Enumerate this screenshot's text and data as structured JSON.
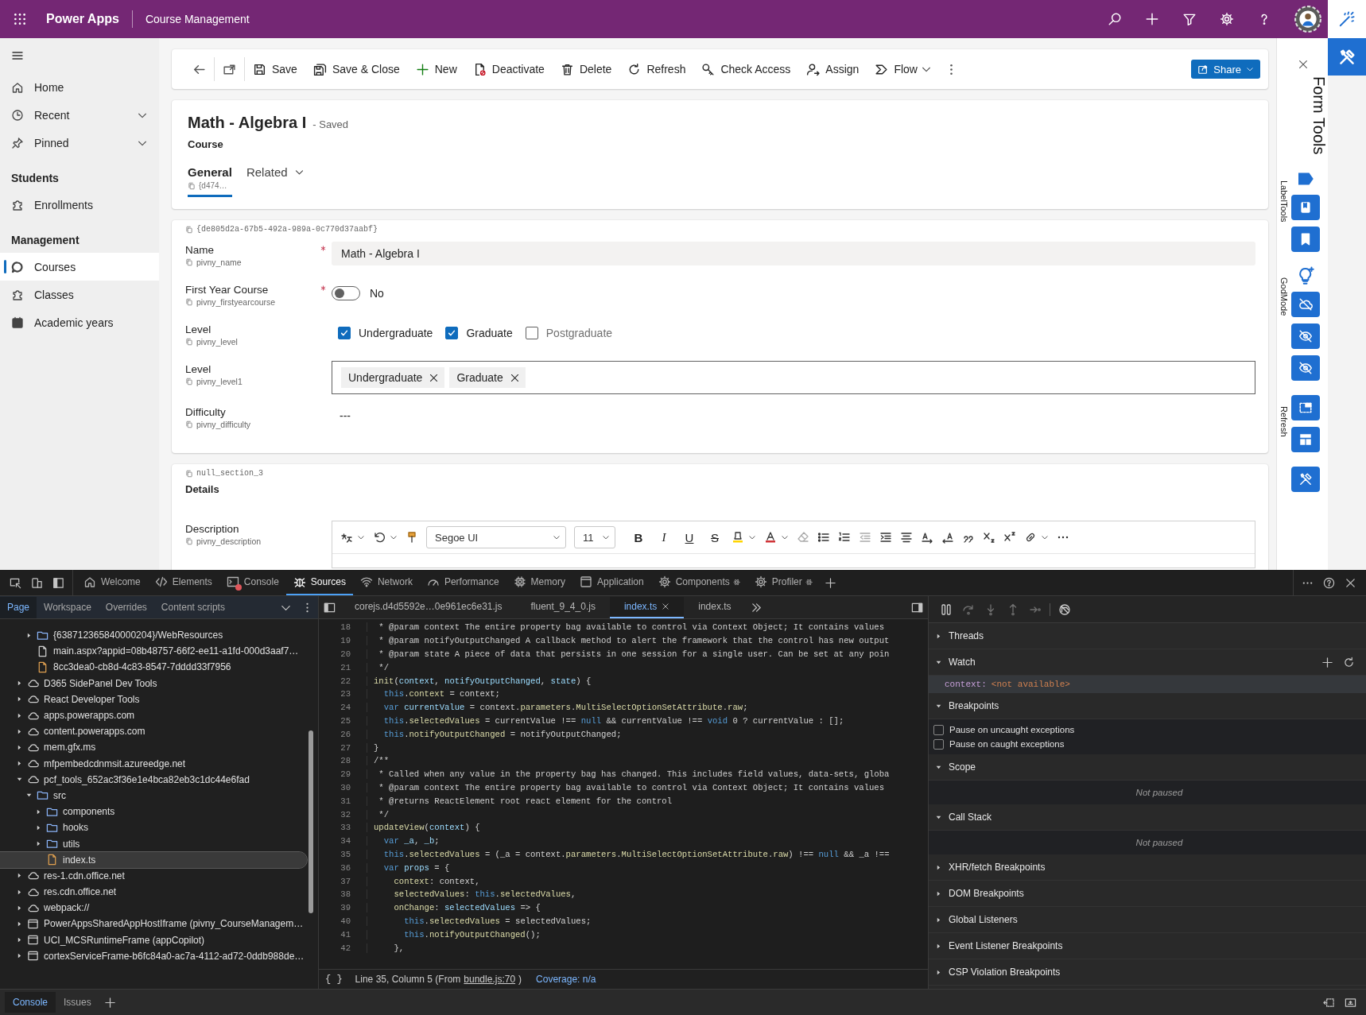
{
  "topbar": {
    "app_name": "Power Apps",
    "title": "Course Management"
  },
  "nav": [
    {
      "kind": "item",
      "label": "Home",
      "selected": false
    },
    {
      "kind": "item",
      "label": "Recent",
      "expanded": false,
      "selected": false
    },
    {
      "kind": "item",
      "label": "Pinned",
      "expanded": false,
      "selected": false
    },
    {
      "kind": "group",
      "label": "Students"
    },
    {
      "kind": "item",
      "label": "Enrollments",
      "selected": false
    },
    {
      "kind": "group",
      "label": "Management"
    },
    {
      "kind": "item",
      "label": "Courses",
      "selected": true
    },
    {
      "kind": "item",
      "label": "Classes",
      "selected": false
    },
    {
      "kind": "item",
      "label": "Academic years",
      "selected": false
    }
  ],
  "commands": [
    "Save",
    "Save & Close",
    "New",
    "Deactivate",
    "Delete",
    "Refresh",
    "Check Access",
    "Assign",
    "Flow"
  ],
  "share": "Share",
  "record": {
    "title": "Math - Algebra I",
    "status": "- Saved",
    "entity": "Course",
    "tabs": [
      {
        "label": "General",
        "selected": true,
        "id": "{d474…"
      },
      {
        "label": "Related",
        "selected": false,
        "dropdown": true
      }
    ]
  },
  "sections": [
    {
      "id": "{de805d2a-67b5-492a-989a-0c770d37aabf}",
      "fields": [
        {
          "kind": "text",
          "label": "Name",
          "schema": "pivny_name",
          "required": true,
          "value": "Math - Algebra I"
        },
        {
          "kind": "toggle",
          "label": "First Year Course",
          "schema": "pivny_firstyearcourse",
          "required": true,
          "on": false,
          "value": "No"
        },
        {
          "kind": "checkboxes",
          "label": "Level",
          "schema": "pivny_level",
          "options": [
            {
              "label": "Undergraduate",
              "checked": true
            },
            {
              "label": "Graduate",
              "checked": true
            },
            {
              "label": "Postgraduate",
              "checked": false
            }
          ]
        },
        {
          "kind": "tags",
          "label": "Level",
          "schema": "pivny_level1",
          "tags": [
            "Undergraduate",
            "Graduate"
          ]
        },
        {
          "kind": "readonly",
          "label": "Difficulty",
          "schema": "pivny_difficulty",
          "value": "---"
        }
      ]
    },
    {
      "id": "null_section_3",
      "title": "Details",
      "fields": [
        {
          "kind": "richtext",
          "label": "Description",
          "schema": "pivny_description",
          "font": "Segoe UI",
          "size": "11",
          "format_buttons": [
            {
              "kind": "bold",
              "glyph": "B"
            },
            {
              "kind": "italic",
              "glyph": "I"
            },
            {
              "kind": "underline",
              "glyph": "U"
            },
            {
              "kind": "strike",
              "glyph": "S"
            }
          ]
        }
      ]
    }
  ],
  "form_tools": {
    "title": "Form Tools",
    "groups": [
      {
        "label": "LabelTools"
      },
      {
        "label": "GodMode"
      },
      {
        "label": "Refresh"
      }
    ]
  },
  "devtools": {
    "tabs": [
      {
        "label": "Welcome",
        "selected": false
      },
      {
        "label": "Elements",
        "selected": false
      },
      {
        "label": "Console",
        "selected": false,
        "error": true
      },
      {
        "label": "Sources",
        "selected": true
      },
      {
        "label": "Network",
        "selected": false
      },
      {
        "label": "Performance",
        "selected": false
      },
      {
        "label": "Memory",
        "selected": false
      },
      {
        "label": "Application",
        "selected": false
      },
      {
        "label": "Components",
        "selected": false,
        "react": true
      },
      {
        "label": "Profiler",
        "selected": false,
        "react": true
      }
    ]
  },
  "sources": {
    "nav_tabs": [
      {
        "label": "Page",
        "selected": true
      },
      {
        "label": "Workspace",
        "selected": false
      },
      {
        "label": "Overrides",
        "selected": false
      },
      {
        "label": "Content scripts",
        "selected": false
      }
    ],
    "tree": [
      {
        "expanded": true,
        "children": [
          {
            "kind": "folder",
            "label": "{638712365840000204}/WebResources",
            "expanded": false,
            "selected": false
          },
          {
            "kind": "file",
            "label": "main.aspx?appid=08b48757-66f2-ee11-a1fd-000d3aaf7…",
            "selected": false
          },
          {
            "kind": "script",
            "label": "8cc3dea0-cb8d-4c83-8547-7dddd33f7956",
            "selected": false
          }
        ]
      },
      {
        "kind": "cloud",
        "label": "D365 SidePanel Dev Tools",
        "expanded": false,
        "selected": false
      },
      {
        "kind": "cloud",
        "label": "React Developer Tools",
        "expanded": false,
        "selected": false
      },
      {
        "kind": "cloud",
        "label": "apps.powerapps.com",
        "expanded": false,
        "selected": false
      },
      {
        "kind": "cloud",
        "label": "content.powerapps.com",
        "expanded": false,
        "selected": false
      },
      {
        "kind": "cloud",
        "label": "mem.gfx.ms",
        "expanded": false,
        "selected": false
      },
      {
        "kind": "cloud",
        "label": "mfpembedcdnmsit.azureedge.net",
        "expanded": false,
        "selected": false
      },
      {
        "kind": "cloud",
        "label": "pcf_tools_652ac3f36e1e4bca82eb3c1dc44e6fad",
        "expanded": true,
        "selected": false,
        "children": [
          {
            "kind": "folder",
            "label": "src",
            "expanded": true,
            "selected": false,
            "children": [
              {
                "kind": "folder",
                "label": "components",
                "expanded": false,
                "selected": false
              },
              {
                "kind": "folder",
                "label": "hooks",
                "expanded": false,
                "selected": false
              },
              {
                "kind": "folder",
                "label": "utils",
                "expanded": false,
                "selected": false
              },
              {
                "kind": "script",
                "label": "index.ts",
                "selected": true
              }
            ]
          }
        ]
      },
      {
        "kind": "cloud",
        "label": "res-1.cdn.office.net",
        "expanded": false,
        "selected": false
      },
      {
        "kind": "cloud",
        "label": "res.cdn.office.net",
        "expanded": false,
        "selected": false
      },
      {
        "kind": "cloud",
        "label": "webpack://",
        "expanded": false,
        "selected": false
      },
      {
        "kind": "frame",
        "label": "PowerAppsSharedAppHostIframe (pivny_CourseManagem…",
        "expanded": false,
        "selected": false
      },
      {
        "kind": "frame",
        "label": "UCI_MCSRuntimeFrame (appCopilot)",
        "expanded": false,
        "selected": false
      },
      {
        "kind": "frame",
        "label": "cortexServiceFrame-b6fc84a0-ac7a-4112-ad72-0ddb988de…",
        "expanded": false,
        "selected": false
      }
    ],
    "editor_tabs": [
      {
        "label": "corejs.d4d5592e…0e961ec6e31.js",
        "selected": false
      },
      {
        "label": "fluent_9_4_0.js",
        "selected": false
      },
      {
        "label": "index.ts",
        "selected": true,
        "closable": true
      },
      {
        "label": "index.ts",
        "selected": false
      }
    ],
    "code": [
      {
        "number": "18",
        "tokens": [
          {
            "kind": "comment",
            "text": " * @param context The entire property bag available to control via Context Object; It contains values"
          }
        ]
      },
      {
        "number": "19",
        "tokens": [
          {
            "kind": "comment",
            "text": " * @param notifyOutputChanged A callback method to alert the framework that the control has new output"
          }
        ]
      },
      {
        "number": "20",
        "tokens": [
          {
            "kind": "comment",
            "text": " * @param state A piece of data that persists in one session for a single user. Can be set at any poin"
          }
        ]
      },
      {
        "number": "21",
        "tokens": [
          {
            "kind": "comment",
            "text": " */"
          }
        ]
      },
      {
        "number": "22",
        "tokens": [
          {
            "kind": "func",
            "text": "init"
          },
          {
            "kind": "plain",
            "text": "("
          },
          {
            "kind": "var",
            "text": "context"
          },
          {
            "kind": "plain",
            "text": ", "
          },
          {
            "kind": "var",
            "text": "notifyOutputChanged"
          },
          {
            "kind": "plain",
            "text": ", "
          },
          {
            "kind": "var",
            "text": "state"
          },
          {
            "kind": "plain",
            "text": ") {"
          }
        ]
      },
      {
        "number": "23",
        "tokens": [
          {
            "kind": "keyword",
            "text": "  this"
          },
          {
            "kind": "plain",
            "text": "."
          },
          {
            "kind": "func",
            "text": "context"
          },
          {
            "kind": "plain",
            "text": " = context;"
          }
        ]
      },
      {
        "number": "24",
        "tokens": [
          {
            "kind": "keyword",
            "text": "  var "
          },
          {
            "kind": "var",
            "text": "currentValue"
          },
          {
            "kind": "plain",
            "text": " = context."
          },
          {
            "kind": "func",
            "text": "parameters"
          },
          {
            "kind": "plain",
            "text": "."
          },
          {
            "kind": "func",
            "text": "MultiSelectOptionSetAttribute"
          },
          {
            "kind": "plain",
            "text": "."
          },
          {
            "kind": "func",
            "text": "raw"
          },
          {
            "kind": "plain",
            "text": ";"
          }
        ]
      },
      {
        "number": "25",
        "tokens": [
          {
            "kind": "keyword",
            "text": "  this"
          },
          {
            "kind": "plain",
            "text": "."
          },
          {
            "kind": "func",
            "text": "selectedValues"
          },
          {
            "kind": "plain",
            "text": " = currentValue !== "
          },
          {
            "kind": "keyword",
            "text": "null"
          },
          {
            "kind": "plain",
            "text": " && currentValue !== "
          },
          {
            "kind": "keyword",
            "text": "void"
          },
          {
            "kind": "plain",
            "text": " 0 ? currentValue : [];"
          }
        ]
      },
      {
        "number": "26",
        "tokens": [
          {
            "kind": "keyword",
            "text": "  this"
          },
          {
            "kind": "plain",
            "text": "."
          },
          {
            "kind": "func",
            "text": "notifyOutputChanged"
          },
          {
            "kind": "plain",
            "text": " = notifyOutputChanged;"
          }
        ]
      },
      {
        "number": "27",
        "tokens": [
          {
            "kind": "plain",
            "text": "}"
          }
        ]
      },
      {
        "number": "28",
        "tokens": [
          {
            "kind": "comment",
            "text": "/**"
          }
        ]
      },
      {
        "number": "29",
        "tokens": [
          {
            "kind": "comment",
            "text": " * Called when any value in the property bag has changed. This includes field values, data-sets, globa"
          }
        ]
      },
      {
        "number": "30",
        "tokens": [
          {
            "kind": "comment",
            "text": " * @param context The entire property bag available to control via Context Object; It contains values"
          }
        ]
      },
      {
        "number": "31",
        "tokens": [
          {
            "kind": "comment",
            "text": " * @returns ReactElement root react element for the control"
          }
        ]
      },
      {
        "number": "32",
        "tokens": [
          {
            "kind": "comment",
            "text": " */"
          }
        ]
      },
      {
        "number": "33",
        "tokens": [
          {
            "kind": "func",
            "text": "updateView"
          },
          {
            "kind": "plain",
            "text": "("
          },
          {
            "kind": "var",
            "text": "context"
          },
          {
            "kind": "plain",
            "text": ") {"
          }
        ]
      },
      {
        "number": "34",
        "tokens": [
          {
            "kind": "keyword",
            "text": "  var "
          },
          {
            "kind": "var",
            "text": "_a"
          },
          {
            "kind": "plain",
            "text": ", "
          },
          {
            "kind": "var",
            "text": "_b"
          },
          {
            "kind": "plain",
            "text": ";"
          }
        ]
      },
      {
        "number": "35",
        "tokens": [
          {
            "kind": "keyword",
            "text": "  this"
          },
          {
            "kind": "plain",
            "text": "."
          },
          {
            "kind": "func",
            "text": "selectedValues"
          },
          {
            "kind": "plain",
            "text": " = (_a = context."
          },
          {
            "kind": "func",
            "text": "parameters"
          },
          {
            "kind": "plain",
            "text": "."
          },
          {
            "kind": "func",
            "text": "MultiSelectOptionSetAttribute"
          },
          {
            "kind": "plain",
            "text": "."
          },
          {
            "kind": "func",
            "text": "raw"
          },
          {
            "kind": "plain",
            "text": ") !== "
          },
          {
            "kind": "keyword",
            "text": "null"
          },
          {
            "kind": "plain",
            "text": " && _a !=="
          }
        ]
      },
      {
        "number": "36",
        "tokens": [
          {
            "kind": "keyword",
            "text": "  var "
          },
          {
            "kind": "var",
            "text": "props"
          },
          {
            "kind": "plain",
            "text": " = {"
          }
        ]
      },
      {
        "number": "37",
        "tokens": [
          {
            "kind": "func",
            "text": "    context"
          },
          {
            "kind": "plain",
            "text": ": context,"
          }
        ]
      },
      {
        "number": "38",
        "tokens": [
          {
            "kind": "func",
            "text": "    selectedValues"
          },
          {
            "kind": "plain",
            "text": ": "
          },
          {
            "kind": "keyword",
            "text": "this"
          },
          {
            "kind": "plain",
            "text": "."
          },
          {
            "kind": "func",
            "text": "selectedValues"
          },
          {
            "kind": "plain",
            "text": ","
          }
        ]
      },
      {
        "number": "39",
        "tokens": [
          {
            "kind": "func",
            "text": "    onChange"
          },
          {
            "kind": "plain",
            "text": ": "
          },
          {
            "kind": "var",
            "text": "selectedValues"
          },
          {
            "kind": "plain",
            "text": " => {"
          }
        ]
      },
      {
        "number": "40",
        "tokens": [
          {
            "kind": "keyword",
            "text": "      this"
          },
          {
            "kind": "plain",
            "text": "."
          },
          {
            "kind": "func",
            "text": "selectedValues"
          },
          {
            "kind": "plain",
            "text": " = selectedValues;"
          }
        ]
      },
      {
        "number": "41",
        "tokens": [
          {
            "kind": "keyword",
            "text": "      this"
          },
          {
            "kind": "plain",
            "text": "."
          },
          {
            "kind": "func",
            "text": "notifyOutputChanged"
          },
          {
            "kind": "plain",
            "text": "();"
          }
        ]
      },
      {
        "number": "42",
        "tokens": [
          {
            "kind": "plain",
            "text": "    },"
          }
        ]
      }
    ],
    "status": {
      "format": "{ }",
      "position": "Line 35, Column 5 (From",
      "source_link": "bundle.js:70",
      "position_end": ")",
      "coverage": "Coverage: n/a"
    }
  },
  "debugger": {
    "step_controls_disabled": true,
    "sections": [
      {
        "title": "Threads",
        "expanded": false
      },
      {
        "title": "Watch",
        "expanded": true,
        "watch": [
          {
            "name": "context:",
            "value": "<not available>"
          }
        ]
      },
      {
        "title": "Breakpoints",
        "expanded": true,
        "options": [
          {
            "label": "Pause on uncaught exceptions",
            "checked": false
          },
          {
            "label": "Pause on caught exceptions",
            "checked": false
          }
        ]
      },
      {
        "title": "Scope",
        "expanded": true,
        "message": "Not paused"
      },
      {
        "title": "Call Stack",
        "expanded": true,
        "message": "Not paused"
      },
      {
        "title": "XHR/fetch Breakpoints",
        "expanded": false
      },
      {
        "title": "DOM Breakpoints",
        "expanded": false
      },
      {
        "title": "Global Listeners",
        "expanded": false
      },
      {
        "title": "Event Listener Breakpoints",
        "expanded": false
      },
      {
        "title": "CSP Violation Breakpoints",
        "expanded": false
      }
    ]
  },
  "drawer": {
    "tabs": [
      {
        "label": "Console",
        "selected": true
      },
      {
        "label": "Issues",
        "selected": false
      }
    ]
  }
}
